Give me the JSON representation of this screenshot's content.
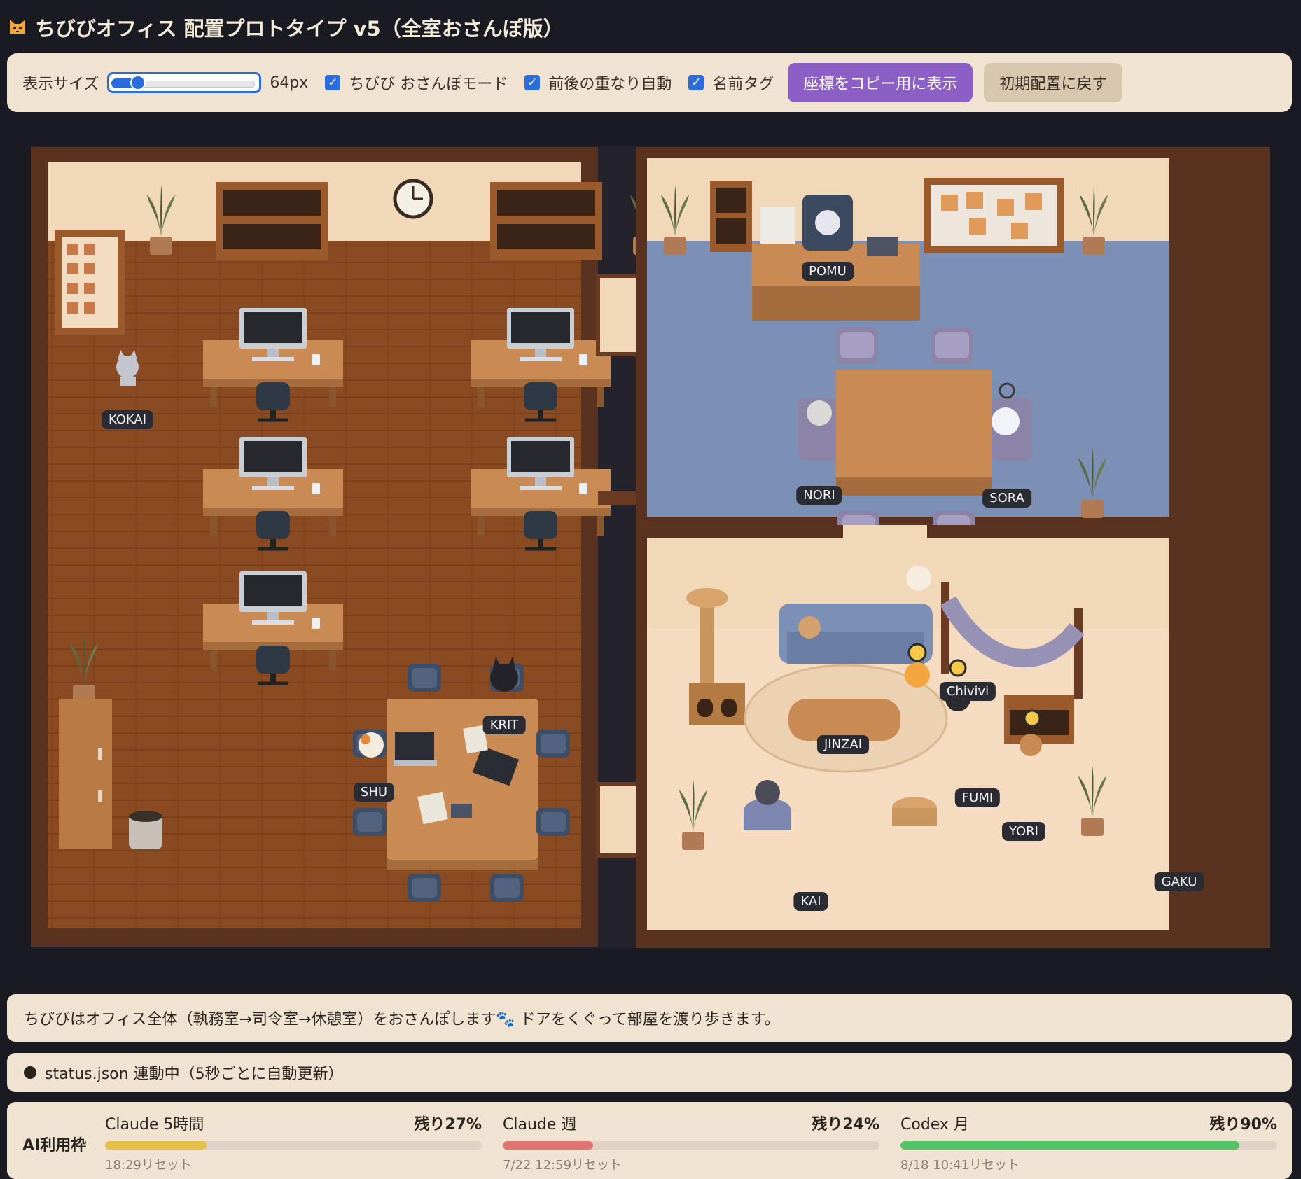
{
  "app": {
    "title": "ちびびオフィス 配置プロトタイプ v5（全室おさんぽ版）"
  },
  "toolbar": {
    "size_label": "表示サイズ",
    "size_value": "64px",
    "size_slider_level": 0.15,
    "checkboxes": [
      {
        "label": "ちびび おさんぽモード",
        "checked": true
      },
      {
        "label": "前後の重なり自動",
        "checked": true
      },
      {
        "label": "名前タグ",
        "checked": true
      }
    ],
    "copy_coords_button": "座標をコピー用に表示",
    "reset_button": "初期配置に戻す"
  },
  "characters": [
    "KOKAI",
    "POMU",
    "NORI",
    "SORA",
    "KRIT",
    "SHU",
    "Chivivi",
    "JINZAI",
    "FUMI",
    "YORI",
    "GAKU",
    "KAI"
  ],
  "note": "ちびびはオフィス全体（執務室→司令室→休憩室）をおさんぽします🐾 ドアをくぐって部屋を渡り歩きます。",
  "status": "status.json 連動中（5秒ごとに自動更新）",
  "usage": {
    "label": "AI利用枠",
    "meters": [
      {
        "name": "Claude 5時間",
        "remaining": "残り27%",
        "used": 0.27,
        "color": "#e6c04a",
        "reset": "18:29リセット"
      },
      {
        "name": "Claude 週",
        "remaining": "残り24%",
        "used": 0.24,
        "color": "#e07474",
        "reset": "7/22 12:59リセット"
      },
      {
        "name": "Codex 月",
        "remaining": "残り90%",
        "used": 0.9,
        "color": "#52c466",
        "reset": "8/18 10:41リセット"
      }
    ]
  }
}
